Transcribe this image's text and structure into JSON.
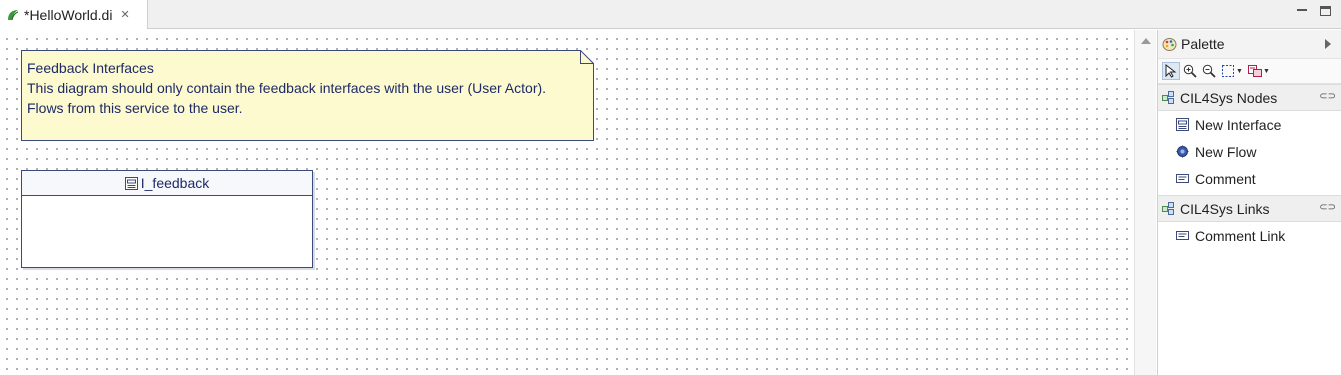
{
  "editor_tab": {
    "title": "*HelloWorld.di",
    "close_symbol": "✕"
  },
  "diagram": {
    "comment": {
      "lines": [
        "Feedback Interfaces",
        "This diagram should only contain the feedback interfaces with the user (User Actor).",
        "Flows from this service to the user."
      ]
    },
    "interface_node": {
      "name": "I_feedback"
    }
  },
  "palette": {
    "title": "Palette",
    "tools": [
      "select-tool",
      "zoom-in-tool",
      "zoom-out-tool",
      "marquee-tool",
      "note-tool"
    ],
    "drawers": [
      {
        "label": "CIL4Sys Nodes",
        "entries": [
          {
            "label": "New Interface",
            "icon": "interface-icon"
          },
          {
            "label": "New Flow",
            "icon": "flow-icon"
          },
          {
            "label": "Comment",
            "icon": "comment-icon"
          }
        ]
      },
      {
        "label": "CIL4Sys Links",
        "entries": [
          {
            "label": "Comment Link",
            "icon": "comment-link-icon"
          }
        ]
      }
    ]
  },
  "colors": {
    "node_text": "#1d2a66",
    "note_fill": "#fdfad0",
    "node_border": "#3b4a7a"
  }
}
